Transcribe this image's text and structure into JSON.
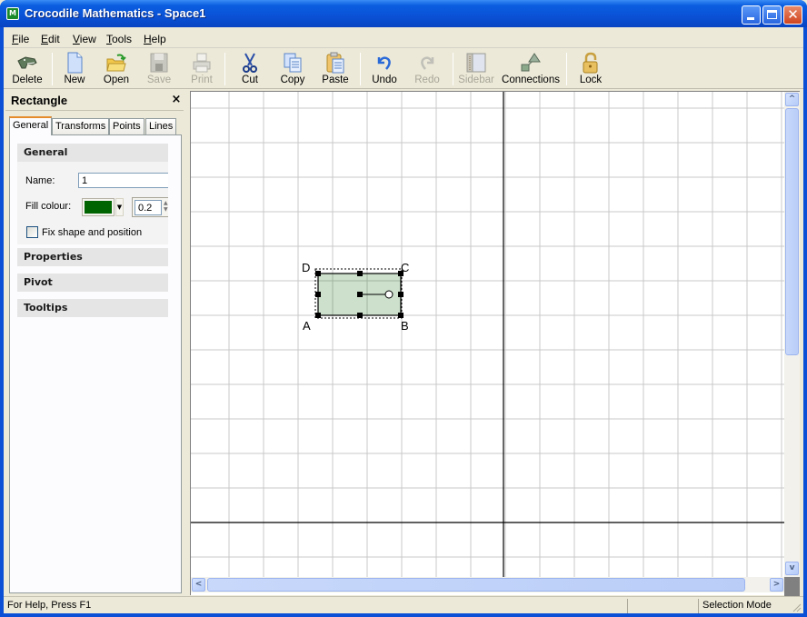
{
  "window": {
    "title": "Crocodile Mathematics - Space1",
    "app_icon": "M",
    "controls": [
      "minimize",
      "maximize",
      "close"
    ]
  },
  "menubar": {
    "items": [
      {
        "label": "File",
        "accel": "F",
        "rest": "ile"
      },
      {
        "label": "Edit",
        "accel": "E",
        "rest": "dit"
      },
      {
        "label": "View",
        "accel": "V",
        "rest": "iew"
      },
      {
        "label": "Tools",
        "accel": "T",
        "rest": "ools"
      },
      {
        "label": "Help",
        "accel": "H",
        "rest": "elp"
      }
    ]
  },
  "toolbar": {
    "buttons": [
      {
        "label": "Delete",
        "icon": "crocodile-icon",
        "enabled": true
      },
      {
        "label": "New",
        "icon": "new-document-icon",
        "enabled": true
      },
      {
        "label": "Open",
        "icon": "open-folder-icon",
        "enabled": true
      },
      {
        "label": "Save",
        "icon": "save-disk-icon",
        "enabled": false
      },
      {
        "label": "Print",
        "icon": "printer-icon",
        "enabled": false
      },
      {
        "label": "Cut",
        "icon": "scissors-icon",
        "enabled": true
      },
      {
        "label": "Copy",
        "icon": "copy-icon",
        "enabled": true
      },
      {
        "label": "Paste",
        "icon": "paste-clipboard-icon",
        "enabled": true
      },
      {
        "label": "Undo",
        "icon": "undo-arrow-icon",
        "enabled": true
      },
      {
        "label": "Redo",
        "icon": "redo-arrow-icon",
        "enabled": false
      },
      {
        "label": "Sidebar",
        "icon": "sidebar-icon",
        "enabled": false
      },
      {
        "label": "Connections",
        "icon": "connections-icon",
        "enabled": true
      },
      {
        "label": "Lock",
        "icon": "padlock-icon",
        "enabled": true
      }
    ]
  },
  "sidebar": {
    "title": "Rectangle",
    "close_glyph": "×",
    "tabs": [
      {
        "label": "General",
        "active": true
      },
      {
        "label": "Transforms",
        "active": false
      },
      {
        "label": "Points",
        "active": false
      },
      {
        "label": "Lines",
        "active": false
      }
    ],
    "general": {
      "heading": "General",
      "name_label": "Name:",
      "name_value": "1",
      "fill_label": "Fill colour:",
      "fill_color": "#006400",
      "opacity_value": "0.2",
      "fix_label": "Fix shape and position",
      "fix_checked": false
    },
    "sections": [
      "Properties",
      "Pivot",
      "Tooltips"
    ]
  },
  "canvas": {
    "shape": "rectangle",
    "fill_color": "#006400",
    "fill_opacity": 0.2,
    "vertex_labels": [
      "A",
      "B",
      "C",
      "D"
    ]
  },
  "statusbar": {
    "help": "For Help, Press F1",
    "middle": "",
    "mode": "Selection Mode"
  }
}
